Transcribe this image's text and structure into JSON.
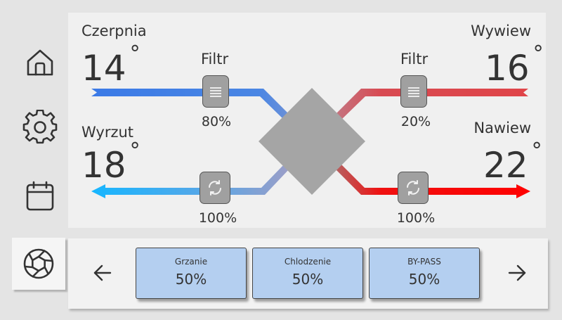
{
  "sidebar": {
    "items": [
      {
        "icon": "home-icon"
      },
      {
        "icon": "gear-icon"
      },
      {
        "icon": "calendar-icon"
      },
      {
        "icon": "fan-icon",
        "active": true
      }
    ]
  },
  "diagram": {
    "intake": {
      "label": "Czerpnia",
      "temp": "14",
      "unit": "°"
    },
    "exhaust_out": {
      "label": "Wyrzut",
      "temp": "18",
      "unit": "°"
    },
    "extract": {
      "label": "Wywiew",
      "temp": "16",
      "unit": "°"
    },
    "supply": {
      "label": "Nawiew",
      "temp": "22",
      "unit": "°"
    },
    "filter_left": {
      "label": "Filtr",
      "value": "80%"
    },
    "filter_right": {
      "label": "Filtr",
      "value": "20%"
    },
    "fan_left": {
      "value": "100%"
    },
    "fan_right": {
      "value": "100%"
    },
    "colors": {
      "cold": "#3b80e8",
      "cold_out": "#20b0ff",
      "warm": "#e05050",
      "hot": "#ff0000",
      "exchanger": "#a5a5a5"
    }
  },
  "modes": [
    {
      "name": "Grzanie",
      "value": "50%"
    },
    {
      "name": "Chlodzenie",
      "value": "50%"
    },
    {
      "name": "BY-PASS",
      "value": "50%"
    }
  ],
  "nav": {
    "prev_icon": "arrow-left-icon",
    "next_icon": "arrow-right-icon"
  }
}
